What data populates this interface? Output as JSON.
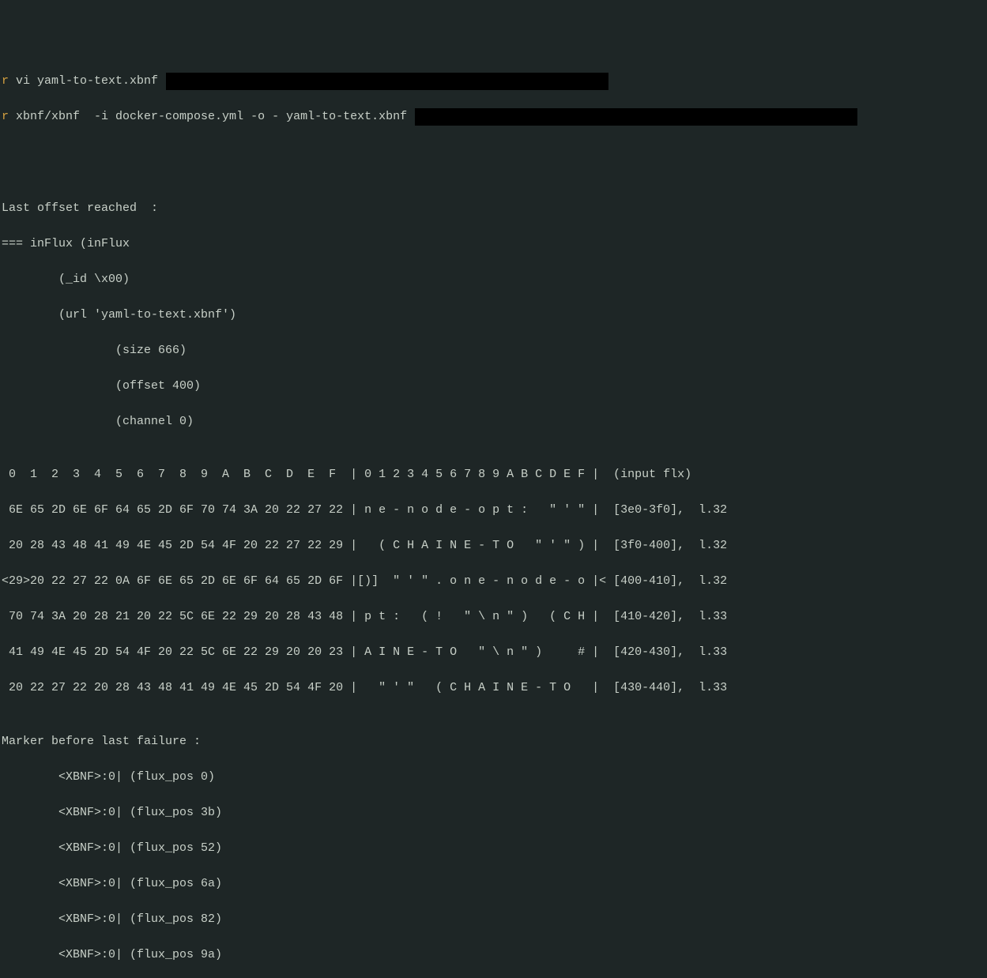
{
  "commands": {
    "cmd1_prefix": "r",
    "cmd1": " vi yaml-to-text.xbnf",
    "cmd2_prefix": "r",
    "cmd2": " xbnf/xbnf  -i docker-compose.yml -o - yaml-to-text.xbnf"
  },
  "output": {
    "blank1": "",
    "blank2": "",
    "offset_header": "Last offset reached  :",
    "influx1": "=== inFlux (inFlux",
    "influx2": "        (_id \\x00)",
    "influx3": "        (url 'yaml-to-text.xbnf')",
    "influx4": "                (size 666)",
    "influx5": "                (offset 400)",
    "influx6": "                (channel 0)",
    "blank3": "",
    "hexhdr": " 0  1  2  3  4  5  6  7  8  9  A  B  C  D  E  F  | 0 1 2 3 4 5 6 7 8 9 A B C D E F |  (input flx)",
    "hex1": " 6E 65 2D 6E 6F 64 65 2D 6F 70 74 3A 20 22 27 22 | n e - n o d e - o p t :   \" ' \" |  [3e0-3f0],  l.32",
    "hex2": " 20 28 43 48 41 49 4E 45 2D 54 4F 20 22 27 22 29 |   ( C H A I N E - T O   \" ' \" ) |  [3f0-400],  l.32",
    "hex3": "<29>20 22 27 22 0A 6F 6E 65 2D 6E 6F 64 65 2D 6F |[)]  \" ' \" . o n e - n o d e - o |< [400-410],  l.32",
    "hex4": " 70 74 3A 20 28 21 20 22 5C 6E 22 29 20 28 43 48 | p t :   ( !   \" \\ n \" )   ( C H |  [410-420],  l.33",
    "hex5": " 41 49 4E 45 2D 54 4F 20 22 5C 6E 22 29 20 20 23 | A I N E - T O   \" \\ n \" )     # |  [420-430],  l.33",
    "hex6": " 20 22 27 22 20 28 43 48 41 49 4E 45 2D 54 4F 20 |   \" ' \"   ( C H A I N E - T O   |  [430-440],  l.33",
    "blank4": "",
    "marker_hdr": "Marker before last failure :",
    "marker1": "        <XBNF>:0| (flux_pos 0)",
    "marker2": "        <XBNF>:0| (flux_pos 3b)",
    "marker3": "        <XBNF>:0| (flux_pos 52)",
    "marker4": "        <XBNF>:0| (flux_pos 6a)",
    "marker5": "        <XBNF>:0| (flux_pos 82)",
    "marker6": "        <XBNF>:0| (flux_pos 9a)"
  }
}
